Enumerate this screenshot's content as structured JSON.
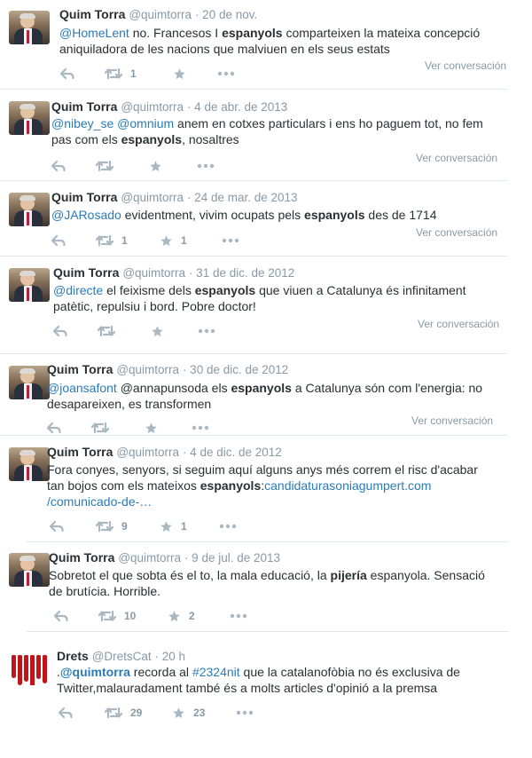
{
  "ui": {
    "ver_conversacio": "Ver conversación"
  },
  "tweets": [
    {
      "name": "Quim Torra",
      "handle": "@quimtorra",
      "date": "· 20 de nov.",
      "segments": [
        {
          "t": "@HomeLent",
          "s": "link"
        },
        {
          "t": " no. Francesos I ",
          "s": ""
        },
        {
          "t": "espanyols",
          "s": "bold"
        },
        {
          "t": " comparteixen la mateixa concepció aniquiladora de les nacions que malviuen en els seus estats",
          "s": ""
        }
      ],
      "retweets": "1",
      "favorites": "",
      "show_conversation": true
    },
    {
      "name": "Quim Torra",
      "handle": "@quimtorra",
      "date": "· 4 de abr. de 2013",
      "segments": [
        {
          "t": "@nibey_se",
          "s": "link"
        },
        {
          "t": " ",
          "s": ""
        },
        {
          "t": "@omnium",
          "s": "link"
        },
        {
          "t": " anem en cotxes particulars i ens ho paguem tot, no fem pas com els ",
          "s": ""
        },
        {
          "t": "espanyols",
          "s": "bold"
        },
        {
          "t": ", nosaltres",
          "s": ""
        }
      ],
      "retweets": "",
      "favorites": "",
      "show_conversation": true
    },
    {
      "name": "Quim Torra",
      "handle": "@quimtorra",
      "date": "· 24 de mar. de 2013",
      "segments": [
        {
          "t": "@JARosado",
          "s": "link"
        },
        {
          "t": " evidentment, vivim ocupats pels ",
          "s": ""
        },
        {
          "t": "espanyols",
          "s": "bold"
        },
        {
          "t": " des de 1714",
          "s": ""
        }
      ],
      "retweets": "1",
      "favorites": "1",
      "show_conversation": true
    },
    {
      "name": "Quim Torra",
      "handle": "@quimtorra",
      "date": "· 31 de dic. de 2012",
      "segments": [
        {
          "t": "@directe",
          "s": "link"
        },
        {
          "t": " el feixisme dels ",
          "s": ""
        },
        {
          "t": "espanyols",
          "s": "bold"
        },
        {
          "t": " que viuen a Catalunya és infinitament patètic, repulsiu i bord. Pobre doctor!",
          "s": ""
        }
      ],
      "retweets": "",
      "favorites": "",
      "show_conversation": true
    },
    {
      "name": "Quim Torra",
      "handle": "@quimtorra",
      "date": "· 30 de dic. de 2012",
      "segments": [
        {
          "t": "@joansafont",
          "s": "link"
        },
        {
          "t": " @annapunsoda els ",
          "s": ""
        },
        {
          "t": "espanyols",
          "s": "bold"
        },
        {
          "t": " a Catalunya són com l'energia: no desapareixen, es transformen",
          "s": ""
        }
      ],
      "retweets": "",
      "favorites": "",
      "show_conversation": true
    },
    {
      "name": "Quim Torra",
      "handle": "@quimtorra",
      "date": "· 4 de dic. de 2012",
      "segments": [
        {
          "t": "Fora conyes, senyors, si seguim aquí alguns anys més correm el risc d'acabar tan bojos com els mateixos ",
          "s": ""
        },
        {
          "t": "espanyols",
          "s": "bold"
        },
        {
          "t": ":",
          "s": ""
        },
        {
          "t": "candidaturasoniagumpert.com /comunicado-de-…",
          "s": "link"
        }
      ],
      "retweets": "9",
      "favorites": "1",
      "show_conversation": false
    },
    {
      "name": "Quim Torra",
      "handle": "@quimtorra",
      "date": "· 9 de jul. de 2013",
      "segments": [
        {
          "t": "Sobretot el que sobta és el to, la mala educació, la ",
          "s": ""
        },
        {
          "t": "pijería",
          "s": "bold"
        },
        {
          "t": " espanyola. Sensació de brutícia. Horrible.",
          "s": ""
        }
      ],
      "retweets": "10",
      "favorites": "2",
      "show_conversation": false
    },
    {
      "name": "Drets",
      "handle": "@DretsCat",
      "date": "· 20 h",
      "segments": [
        {
          "t": ".",
          "s": ""
        },
        {
          "t": "@quimtorra",
          "s": "link-bold"
        },
        {
          "t": " recorda al ",
          "s": ""
        },
        {
          "t": "#2324nit",
          "s": "link"
        },
        {
          "t": " que la catalanofòbia no és exclusiva de Twitter,malauradament també és a molts articles d'opinió a la premsa",
          "s": ""
        }
      ],
      "retweets": "29",
      "favorites": "23",
      "show_conversation": false
    }
  ]
}
